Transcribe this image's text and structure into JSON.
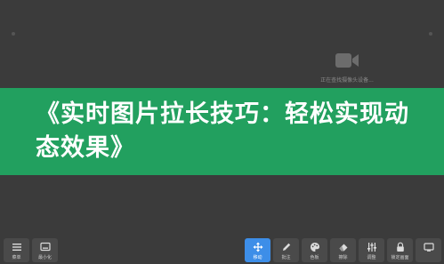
{
  "camera": {
    "status": "正在查找摄像头设备..."
  },
  "title": {
    "text": "《实时图片拉长技巧：轻松实现动态效果》"
  },
  "toolbar_left": [
    {
      "label": "菜单",
      "icon": "menu-icon"
    },
    {
      "label": "最小化",
      "icon": "minimize-icon"
    }
  ],
  "toolbar_right": [
    {
      "label": "移动",
      "icon": "move-icon",
      "active": true
    },
    {
      "label": "批注",
      "icon": "pen-icon"
    },
    {
      "label": "色板",
      "icon": "palette-icon"
    },
    {
      "label": "擦除",
      "icon": "eraser-icon"
    },
    {
      "label": "调整",
      "icon": "adjust-icon"
    },
    {
      "label": "锁定画面",
      "icon": "lock-icon"
    },
    {
      "label": "",
      "icon": "screen-icon"
    }
  ],
  "colors": {
    "banner": "#22a05f",
    "active": "#3d8ee8",
    "background": "#3b3b3b"
  }
}
